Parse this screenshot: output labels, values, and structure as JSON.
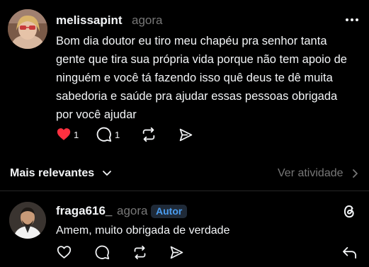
{
  "post": {
    "username": "melissapint",
    "time": "agora",
    "text": "Bom dia doutor eu tiro meu chapéu pra senhor tanta gente que tira sua própria vida porque não tem apoio de ninguém e você tá fazendo isso quê deus te dê muita sabedoria e saúde pra ajudar essas pessoas obrigada por você ajudar",
    "like_count": "1",
    "comment_count": "1",
    "liked": true
  },
  "sort": {
    "label": "Mais relevantes",
    "activity_label": "Ver atividade"
  },
  "reply": {
    "username": "fraga616_",
    "time": "agora",
    "badge": "Autor",
    "text": "Amem, muito obrigada de verdade"
  },
  "colors": {
    "like_red": "#ff3040",
    "badge_blue": "#4a9df0",
    "muted": "#777777"
  }
}
